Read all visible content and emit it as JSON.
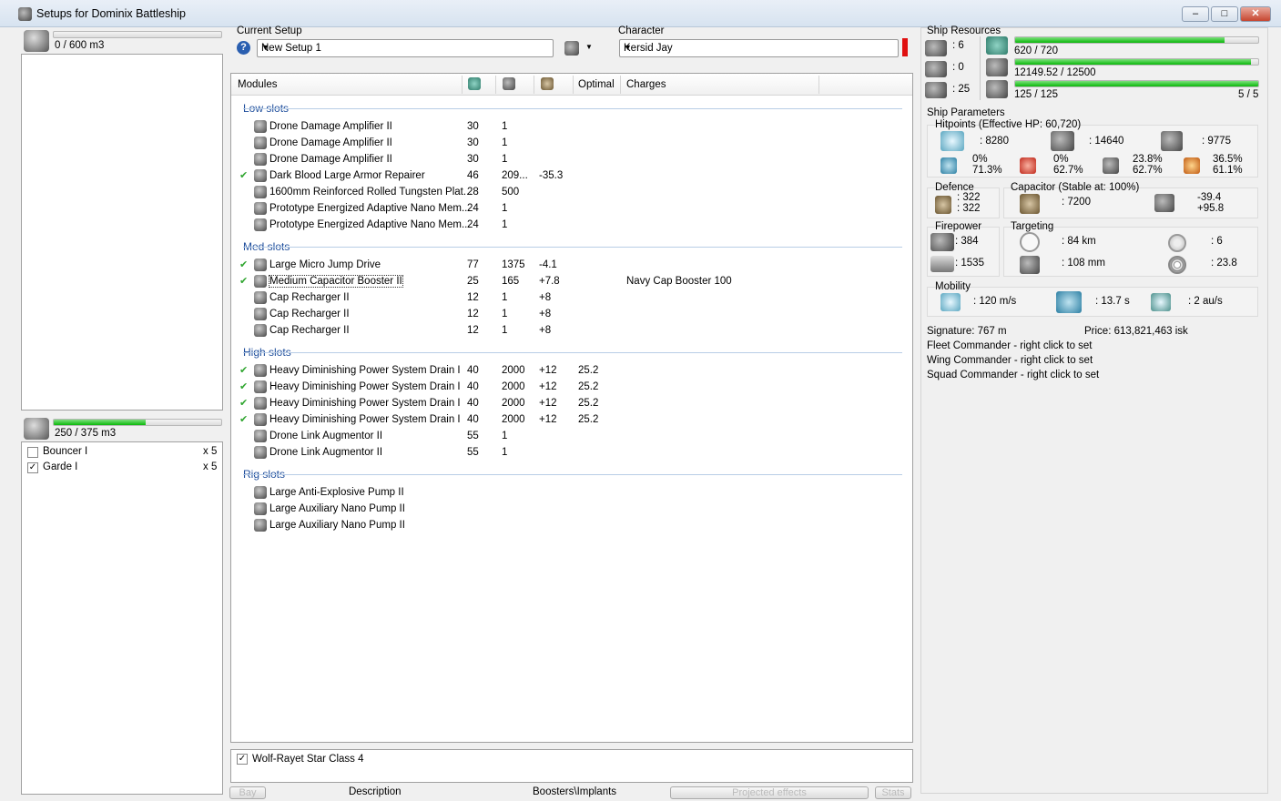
{
  "window": {
    "title": "Setups for Dominix Battleship",
    "min": "–",
    "max": "□",
    "close": "✕"
  },
  "cargo": {
    "label": "0 / 600 m3",
    "fill": 0.0
  },
  "drone_bay": {
    "label": "250 / 375 m3",
    "fill": 0.55,
    "items": [
      {
        "name": "Bouncer I",
        "qty": "x 5",
        "checked": false
      },
      {
        "name": "Garde I",
        "qty": "x 5",
        "checked": true
      }
    ]
  },
  "setup": {
    "label": "Current Setup",
    "value": "New Setup 1"
  },
  "character": {
    "label": "Character",
    "value": "Kersid Jay"
  },
  "modules": {
    "headers": {
      "name": "Modules",
      "optimal": "Optimal",
      "charges": "Charges"
    },
    "sections": [
      {
        "title": "Low slots",
        "rows": [
          {
            "check": false,
            "name": "Drone Damage Amplifier II",
            "c1": "30",
            "c2": "1",
            "c3": "",
            "c4": "",
            "c5": ""
          },
          {
            "check": false,
            "name": "Drone Damage Amplifier II",
            "c1": "30",
            "c2": "1",
            "c3": "",
            "c4": "",
            "c5": ""
          },
          {
            "check": false,
            "name": "Drone Damage Amplifier II",
            "c1": "30",
            "c2": "1",
            "c3": "",
            "c4": "",
            "c5": ""
          },
          {
            "check": true,
            "name": "Dark Blood Large Armor Repairer",
            "c1": "46",
            "c2": "209...",
            "c3": "-35.3",
            "c4": "",
            "c5": ""
          },
          {
            "check": false,
            "name": "1600mm Reinforced Rolled Tungsten Plat...",
            "c1": "28",
            "c2": "500",
            "c3": "",
            "c4": "",
            "c5": ""
          },
          {
            "check": false,
            "name": "Prototype Energized Adaptive Nano Mem...",
            "c1": "24",
            "c2": "1",
            "c3": "",
            "c4": "",
            "c5": ""
          },
          {
            "check": false,
            "name": "Prototype Energized Adaptive Nano Mem...",
            "c1": "24",
            "c2": "1",
            "c3": "",
            "c4": "",
            "c5": ""
          }
        ]
      },
      {
        "title": "Med slots",
        "rows": [
          {
            "check": true,
            "name": "Large Micro Jump Drive",
            "c1": "77",
            "c2": "1375",
            "c3": "-4.1",
            "c4": "",
            "c5": ""
          },
          {
            "check": true,
            "name": "Medium Capacitor Booster II",
            "c1": "25",
            "c2": "165",
            "c3": "+7.8",
            "c4": "",
            "c5": "Navy Cap Booster 100"
          },
          {
            "check": false,
            "name": "Cap Recharger II",
            "c1": "12",
            "c2": "1",
            "c3": "+8",
            "c4": "",
            "c5": ""
          },
          {
            "check": false,
            "name": "Cap Recharger II",
            "c1": "12",
            "c2": "1",
            "c3": "+8",
            "c4": "",
            "c5": ""
          },
          {
            "check": false,
            "name": "Cap Recharger II",
            "c1": "12",
            "c2": "1",
            "c3": "+8",
            "c4": "",
            "c5": ""
          }
        ]
      },
      {
        "title": "High slots",
        "rows": [
          {
            "check": true,
            "name": "Heavy Diminishing Power System Drain I",
            "c1": "40",
            "c2": "2000",
            "c3": "+12",
            "c4": "25.2",
            "c5": ""
          },
          {
            "check": true,
            "name": "Heavy Diminishing Power System Drain I",
            "c1": "40",
            "c2": "2000",
            "c3": "+12",
            "c4": "25.2",
            "c5": ""
          },
          {
            "check": true,
            "name": "Heavy Diminishing Power System Drain I",
            "c1": "40",
            "c2": "2000",
            "c3": "+12",
            "c4": "25.2",
            "c5": ""
          },
          {
            "check": true,
            "name": "Heavy Diminishing Power System Drain I",
            "c1": "40",
            "c2": "2000",
            "c3": "+12",
            "c4": "25.2",
            "c5": ""
          },
          {
            "check": false,
            "name": "Drone Link Augmentor II",
            "c1": "55",
            "c2": "1",
            "c3": "",
            "c4": "",
            "c5": ""
          },
          {
            "check": false,
            "name": "Drone Link Augmentor II",
            "c1": "55",
            "c2": "1",
            "c3": "",
            "c4": "",
            "c5": ""
          }
        ]
      },
      {
        "title": "Rig slots",
        "rows": [
          {
            "check": false,
            "name": "Large Anti-Explosive Pump II",
            "c1": "",
            "c2": "",
            "c3": "",
            "c4": "",
            "c5": ""
          },
          {
            "check": false,
            "name": "Large Auxiliary Nano Pump II",
            "c1": "",
            "c2": "",
            "c3": "",
            "c4": "",
            "c5": ""
          },
          {
            "check": false,
            "name": "Large Auxiliary Nano Pump II",
            "c1": "",
            "c2": "",
            "c3": "",
            "c4": "",
            "c5": ""
          }
        ]
      }
    ]
  },
  "environment": {
    "label": "Wolf-Rayet Star Class 4",
    "checked": true
  },
  "bottom_tabs": [
    "Bay",
    "Description",
    "Boosters\\Implants",
    "Projected effects",
    "Stats"
  ],
  "resources": {
    "title": "Ship Resources",
    "turrets": ": 6",
    "launchers": ": 0",
    "drones": ": 25",
    "cpu": "620 / 720",
    "cpu_fill": 0.86,
    "power": "12149.52 / 12500",
    "power_fill": 0.97,
    "bandwidth": "125 / 125",
    "bandwidth_fill": 1.0,
    "drones_active": "5 / 5"
  },
  "params": {
    "title": "Ship Parameters",
    "hp": {
      "title": "Hitpoints (Effective HP: 60,720)",
      "shield": ": 8280",
      "armor": ": 14640",
      "hull": ": 9775",
      "em": [
        "0%",
        "71.3%"
      ],
      "thermal": [
        "0%",
        "62.7%"
      ],
      "kinetic": [
        "23.8%",
        "62.7%"
      ],
      "explosive": [
        "36.5%",
        "61.1%"
      ]
    },
    "defence": {
      "title": "Defence",
      "a": ": 322",
      "b": ": 322"
    },
    "capacitor": {
      "title": "Capacitor (Stable at: 100%)",
      "amount": ": 7200",
      "a": "-39.4",
      "b": "+95.8"
    },
    "firepower": {
      "title": "Firepower",
      "a": ": 384",
      "b": ": 1535"
    },
    "targeting": {
      "title": "Targeting",
      "range": ": 84 km",
      "drone_range": ": 108 mm",
      "targets": ": 6",
      "scan": ": 23.8"
    },
    "mobility": {
      "title": "Mobility",
      "speed": ": 120 m/s",
      "align": ": 13.7 s",
      "warp": ": 2 au/s"
    },
    "signature": "Signature: 767 m",
    "price": "Price: 613,821,463 isk",
    "fleet": "Fleet Commander - right click to set",
    "wing": "Wing Commander - right click to set",
    "squad": "Squad Commander - right click to set"
  }
}
